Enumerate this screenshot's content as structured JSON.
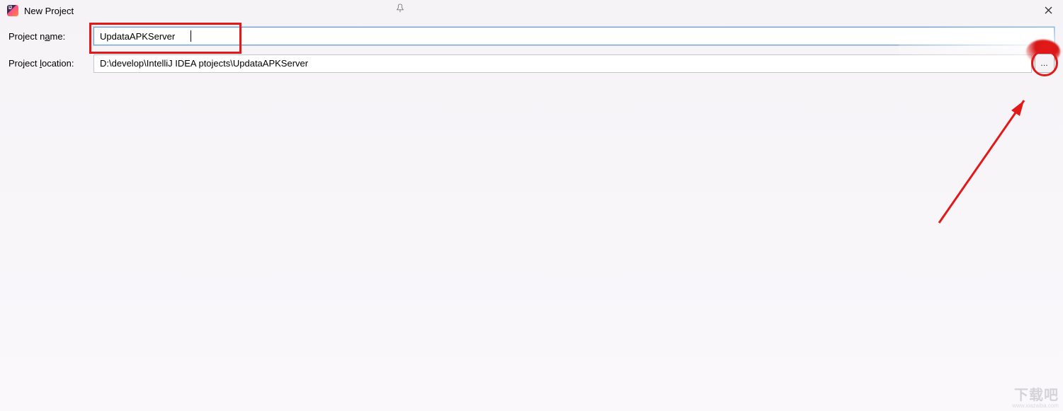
{
  "window": {
    "title": "New Project",
    "close_label": "Close"
  },
  "form": {
    "project_name": {
      "label_prefix": "Project n",
      "label_underlined": "a",
      "label_suffix": "me:",
      "value": "UpdataAPKServer"
    },
    "project_location": {
      "label_prefix": "Project ",
      "label_underlined": "l",
      "label_suffix": "ocation:",
      "value": "D:\\develop\\IntelliJ IDEA ptojects\\UpdataAPKServer",
      "browse_label": "…"
    }
  },
  "watermark": {
    "text": "下载吧",
    "sub": "www.xiazaiba.com"
  }
}
